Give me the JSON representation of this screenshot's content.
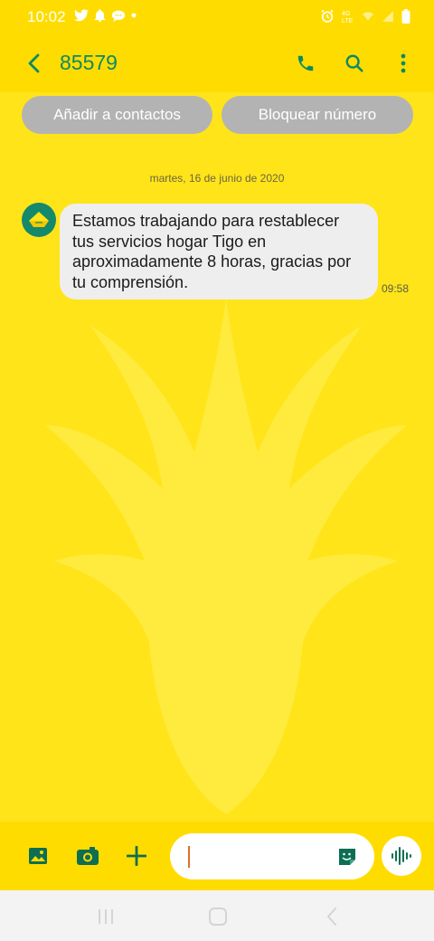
{
  "status_bar": {
    "time": "10:02",
    "left_icons": [
      "twitter-icon",
      "bell-icon",
      "chat-icon",
      "dot-icon"
    ],
    "right_icons": [
      "alarm-icon",
      "data-icon",
      "wifi-icon",
      "signal-icon",
      "battery-icon"
    ]
  },
  "header": {
    "back_icon": "chevron-left-icon",
    "title": "85579",
    "actions": [
      "phone-icon",
      "search-icon",
      "more-vert-icon"
    ]
  },
  "actions": {
    "add_contact": "Añadir a contactos",
    "block_number": "Bloquear número"
  },
  "conversation": {
    "date": "martes, 16 de junio de 2020",
    "messages": [
      {
        "text": "Estamos trabajando para restablecer tus servicios hogar Tigo en aproximadamente 8 horas, gracias por tu comprensión.",
        "time": "09:58",
        "avatar_icon": "tigo-logo-icon"
      }
    ]
  },
  "composer": {
    "value": "",
    "placeholder": "",
    "left_icons": [
      "gallery-icon",
      "camera-icon",
      "add-icon"
    ],
    "sticker_icon": "sticker-icon",
    "voice_icon": "voice-wave-icon"
  },
  "nav": {
    "items": [
      "recent-apps-icon",
      "home-icon",
      "back-icon"
    ]
  },
  "colors": {
    "background": "#ffe41a",
    "bar": "#ffdc00",
    "accent": "#0d8a64",
    "bubble": "#eeeeee",
    "pill": "#b3b3b3"
  }
}
